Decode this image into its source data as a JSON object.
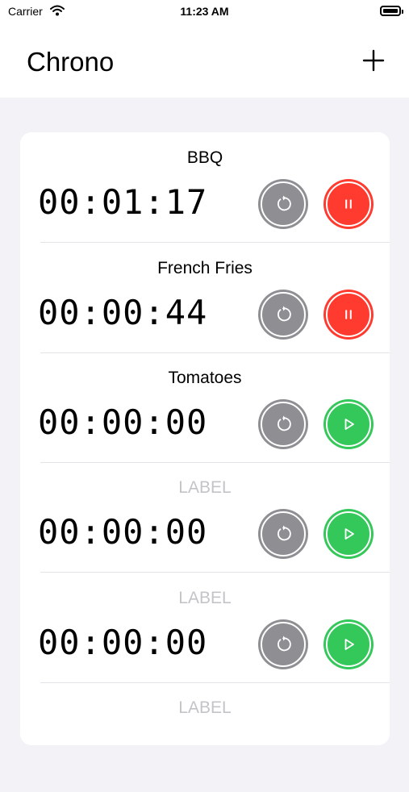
{
  "status_bar": {
    "carrier": "Carrier",
    "time": "11:23 AM"
  },
  "nav": {
    "title": "Chrono",
    "add_icon": "plus-icon"
  },
  "timers": [
    {
      "label": "BBQ",
      "time": "00:01:17",
      "state": "running",
      "action_icon": "pause-icon"
    },
    {
      "label": "French Fries",
      "time": "00:00:44",
      "state": "running",
      "action_icon": "pause-icon"
    },
    {
      "label": "Tomatoes",
      "time": "00:00:00",
      "state": "stopped",
      "action_icon": "play-icon"
    },
    {
      "label": "LABEL",
      "time": "00:00:00",
      "state": "stopped",
      "action_icon": "play-icon",
      "placeholder": true
    },
    {
      "label": "LABEL",
      "time": "00:00:00",
      "state": "stopped",
      "action_icon": "play-icon",
      "placeholder": true
    },
    {
      "label": "LABEL",
      "placeholder": true
    }
  ],
  "colors": {
    "background": "#f2f2f7",
    "reset_button": "#8e8e93",
    "pause_button": "#ff3b30",
    "play_button": "#34c759",
    "placeholder_text": "#c4c4c8"
  }
}
